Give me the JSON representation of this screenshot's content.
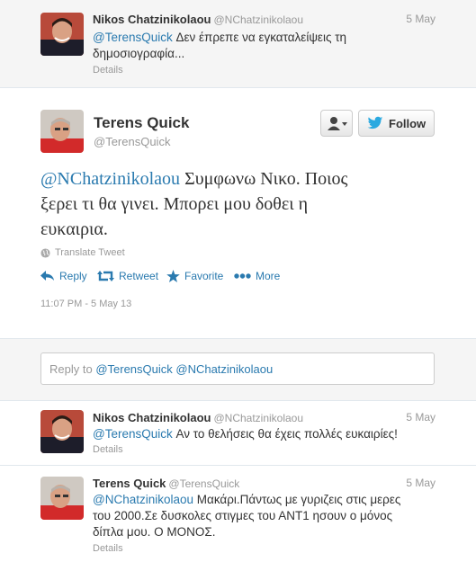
{
  "top_tweet": {
    "name": "Nikos Chatzinikolaou",
    "handle": "@NChatzinikolaou",
    "date": "5 May",
    "mention": "@TerensQuick",
    "text_line1": " Δεν έπρεπε να εγκαταλείψεις τη",
    "text_line2": "δημοσιογραφία...",
    "details": "Details"
  },
  "main_tweet": {
    "name": "Terens Quick",
    "handle": "@TerensQuick",
    "follow_label": "Follow",
    "mention": "@NChatzinikolaou",
    "text_line1": " Συμφωνω Νικο. Ποιος",
    "text_line2": "ξερει τι θα γινει. Μπορει μου δοθει η",
    "text_line3": "ευκαιρια.",
    "translate": "Translate Tweet",
    "actions": {
      "reply": "Reply",
      "retweet": "Retweet",
      "favorite": "Favorite",
      "more": "More"
    },
    "timestamp": "11:07 PM - 5 May 13"
  },
  "reply_box": {
    "prefix": "Reply to ",
    "mentions": "@TerensQuick @NChatzinikolaou"
  },
  "reply1": {
    "name": "Nikos Chatzinikolaou",
    "handle": "@NChatzinikolaou",
    "date": "5 May",
    "mention": "@TerensQuick",
    "text": " Αν το θελήσεις θα έχεις πολλές ευκαιρίες!",
    "details": "Details"
  },
  "reply2": {
    "name": "Terens Quick",
    "handle": "@TerensQuick",
    "date": "5 May",
    "mention": "@NChatzinikolaou",
    "text_line1": " Μακάρι.Πάντως με γυριζεις στις μερες",
    "text_line2": "του 2000.Σε δυσκολες στιγμες του ΑΝΤ1 ησουν ο μόνος",
    "text_line3": "δίπλα μου. Ο ΜΟΝΟΣ.",
    "details": "Details"
  },
  "icons": {
    "user_menu": "user-dropdown-icon",
    "follow_bird": "twitter-bird-icon",
    "translate": "globe-icon",
    "reply": "reply-arrow-icon",
    "retweet": "retweet-icon",
    "favorite": "star-icon",
    "more": "dots-icon"
  },
  "colors": {
    "link": "#2a7aaf",
    "bird": "#2aa9e0",
    "grey_bg": "#f5f5f5"
  }
}
